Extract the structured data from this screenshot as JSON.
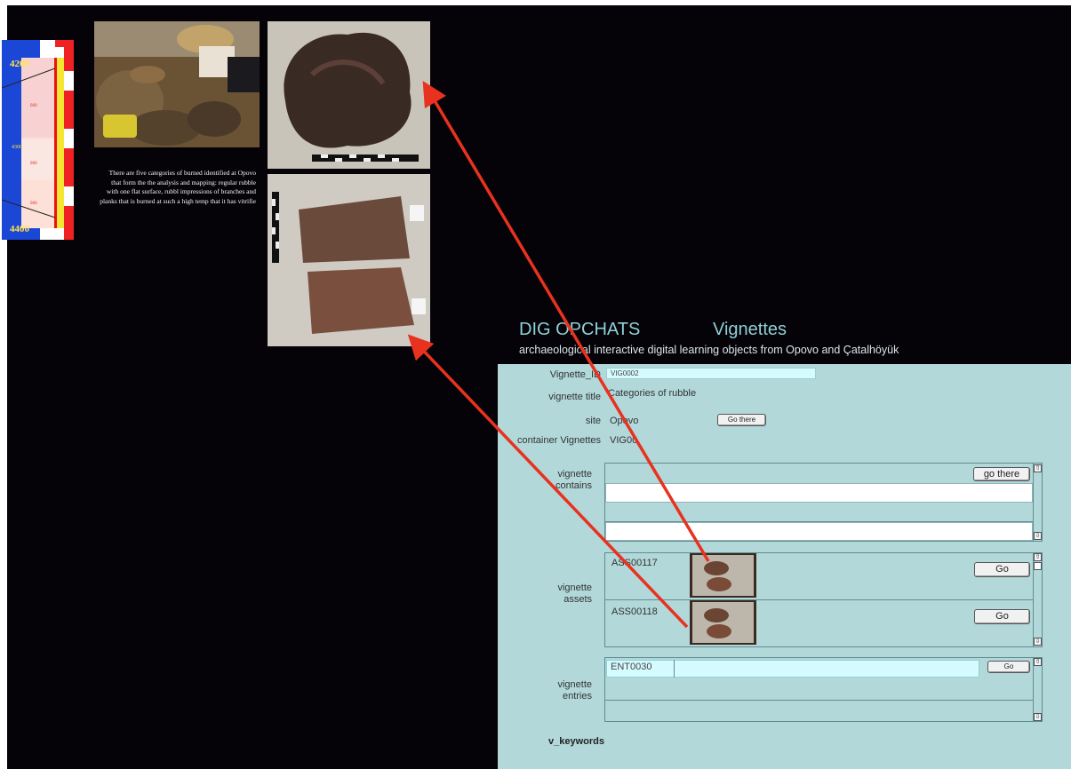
{
  "app": {
    "title": "DIG OPCHATS",
    "section": "Vignettes",
    "subtitle": "archaeological interactive digital learning objects from Opovo and Çatalhöyük"
  },
  "collage": {
    "scale_ticks": [
      "4200",
      "4300",
      "4400"
    ],
    "description": "There are five categories of burned identified at Opovo that form the the analysis and mapping: regular rubble with one flat surface, rubbl impressions of branches and planks that is burned at such a high temp that it has vitrifie"
  },
  "form": {
    "vignette_id_label": "Vignette_ID",
    "vignette_id": "VIG0002",
    "title_label": "vignette title",
    "title_value": "Categories of rubble",
    "site_label": "site",
    "site_value": "Opovo",
    "site_button": "Go there",
    "container_label": "container Vignettes",
    "container_value": "VIG00",
    "contains_label": "vignette contains",
    "contains_button": "go there",
    "assets_label": "vignette assets",
    "assets": [
      {
        "id": "ASS00117",
        "button": "Go"
      },
      {
        "id": "ASS00118",
        "button": "Go"
      }
    ],
    "entries_label": "vignette entries",
    "entries": [
      {
        "id": "ENT0030",
        "button": "Go"
      }
    ],
    "keywords_label": "v_keywords"
  },
  "colors": {
    "background": "#050308",
    "panel": "#b2d8da",
    "title": "#8fd0d8",
    "arrow": "#e8321f",
    "field": "#d6fbff"
  },
  "icons": [
    "scroll-up-icon",
    "scroll-down-icon",
    "red-arrow-annotation"
  ]
}
